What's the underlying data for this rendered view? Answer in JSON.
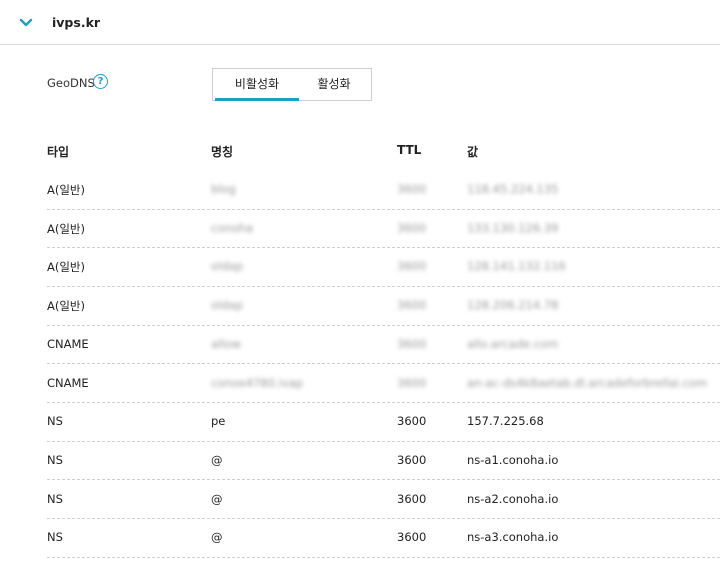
{
  "header": {
    "domain": "ivps.kr"
  },
  "geodns": {
    "label": "GeoDNS",
    "help_icon": "?",
    "options": [
      "비활성화",
      "활성화"
    ],
    "selected": "비활성화"
  },
  "table": {
    "columns": [
      "타입",
      "명칭",
      "TTL",
      "값"
    ],
    "rows": [
      {
        "type": "A(일반)",
        "name": "blog",
        "ttl": "3600",
        "value": "118.45.224.135"
      },
      {
        "type": "A(일반)",
        "name": "conoha",
        "ttl": "3600",
        "value": "133.130.126.39"
      },
      {
        "type": "A(일반)",
        "name": "oldap",
        "ttl": "3600",
        "value": "128.141.132.116"
      },
      {
        "type": "A(일반)",
        "name": "oldap",
        "ttl": "3600",
        "value": "128.206.214.78"
      },
      {
        "type": "CNAME",
        "name": "allow",
        "ttl": "3600",
        "value": "allo.arcade.com"
      },
      {
        "type": "CNAME",
        "name": "conoe4780.ivap",
        "ttl": "3600",
        "value": "an-ac-ds4k8aetab.dl.arcadeforbrellai.com"
      },
      {
        "type": "NS",
        "name": "pe",
        "ttl": "3600",
        "value": "157.7.225.68"
      },
      {
        "type": "NS",
        "name": "@",
        "ttl": "3600",
        "value": "ns-a1.conoha.io"
      },
      {
        "type": "NS",
        "name": "@",
        "ttl": "3600",
        "value": "ns-a2.conoha.io"
      },
      {
        "type": "NS",
        "name": "@",
        "ttl": "3600",
        "value": "ns-a3.conoha.io"
      }
    ]
  }
}
